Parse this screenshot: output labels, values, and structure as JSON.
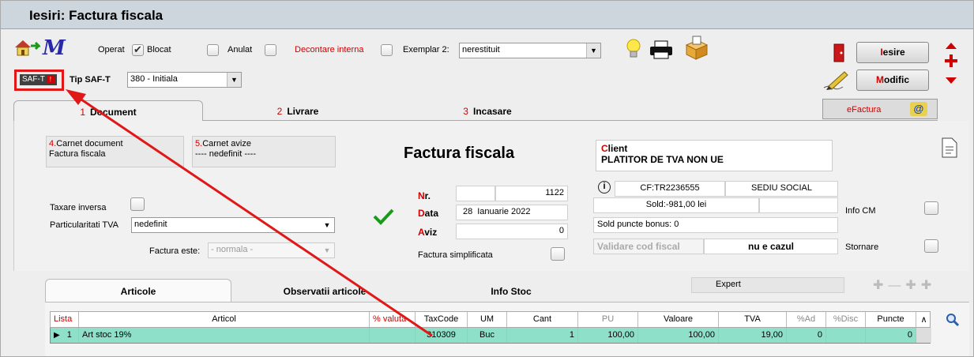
{
  "window": {
    "title": "Iesiri: Factura fiscala"
  },
  "toolbar": {
    "operat_label": "Operat",
    "blocat_label": "Blocat",
    "anulat_label": "Anulat",
    "decontare_label": "Decontare interna",
    "exemplar_label": "Exemplar 2:",
    "exemplar_value": "nerestituit",
    "saft_badge": "SAF-T",
    "tip_saft_label": "Tip SAF-T",
    "tip_saft_value": "380 - Initiala",
    "iesire_button": {
      "hot": "I",
      "rest": "esire"
    },
    "modific_button": {
      "hot": "M",
      "rest": "odific"
    },
    "efactura_label": "eFactura"
  },
  "tabs": [
    {
      "num": "1",
      "label": "Document"
    },
    {
      "num": "2",
      "label": "Livrare"
    },
    {
      "num": "3",
      "label": "Incasare"
    }
  ],
  "carnet": {
    "doc_num": "4.",
    "doc_label": "Carnet document",
    "doc_value": "Factura fiscala",
    "avize_num": "5.",
    "avize_label": "Carnet avize",
    "avize_value": "---- nedefinit ----"
  },
  "document": {
    "heading": "Factura fiscala",
    "nr_label_hot": "N",
    "nr_label_rest": "r.",
    "nr_value": "1122",
    "data_label_hot": "D",
    "data_label_rest": "ata",
    "data_day": "28",
    "data_month_year": "Ianuarie 2022",
    "aviz_label_hot": "A",
    "aviz_label_rest": "viz",
    "aviz_value": "0",
    "simplificata_label": "Factura simplificata"
  },
  "taxare": {
    "taxare_inversa_label": "Taxare inversa",
    "particularitati_label": "Particularitati TVA",
    "particularitati_value": "nedefinit",
    "factura_este_label": "Factura este:",
    "factura_este_value": "- normala -"
  },
  "client": {
    "label_hot": "C",
    "label_rest": "lient",
    "name": "PLATITOR DE TVA NON UE",
    "cf": "CF:TR2236555",
    "sediu": "SEDIU SOCIAL",
    "sold": "Sold:-981,00 lei",
    "sold_puncte": "Sold puncte bonus: 0",
    "validare_label": "Validare cod fiscal",
    "validare_value": "nu e cazul",
    "info_cm_label": "Info CM",
    "stornare_label": "Stornare"
  },
  "subtabs": [
    {
      "label": "Articole"
    },
    {
      "label": "Observatii articole"
    },
    {
      "label": "Info Stoc"
    }
  ],
  "expert_label": "Expert",
  "grid": {
    "columns": [
      "Lista",
      "Articol",
      "% valuta",
      "TaxCode",
      "UM",
      "Cant",
      "PU",
      "Valoare",
      "TVA",
      "%Ad",
      "%Disc",
      "Puncte"
    ],
    "rows": [
      {
        "lista": "1",
        "articol": "Art stoc 19%",
        "valuta": "",
        "taxcode": "310309",
        "um": "Buc",
        "cant": "1",
        "pu": "100,00",
        "valoare": "100,00",
        "tva": "19,00",
        "ad": "0",
        "disc": "",
        "puncte": "0"
      }
    ]
  },
  "colors": {
    "accent_red": "#d00000",
    "row_highlight": "#8ee0c8",
    "annotation_red": "#e01818"
  }
}
